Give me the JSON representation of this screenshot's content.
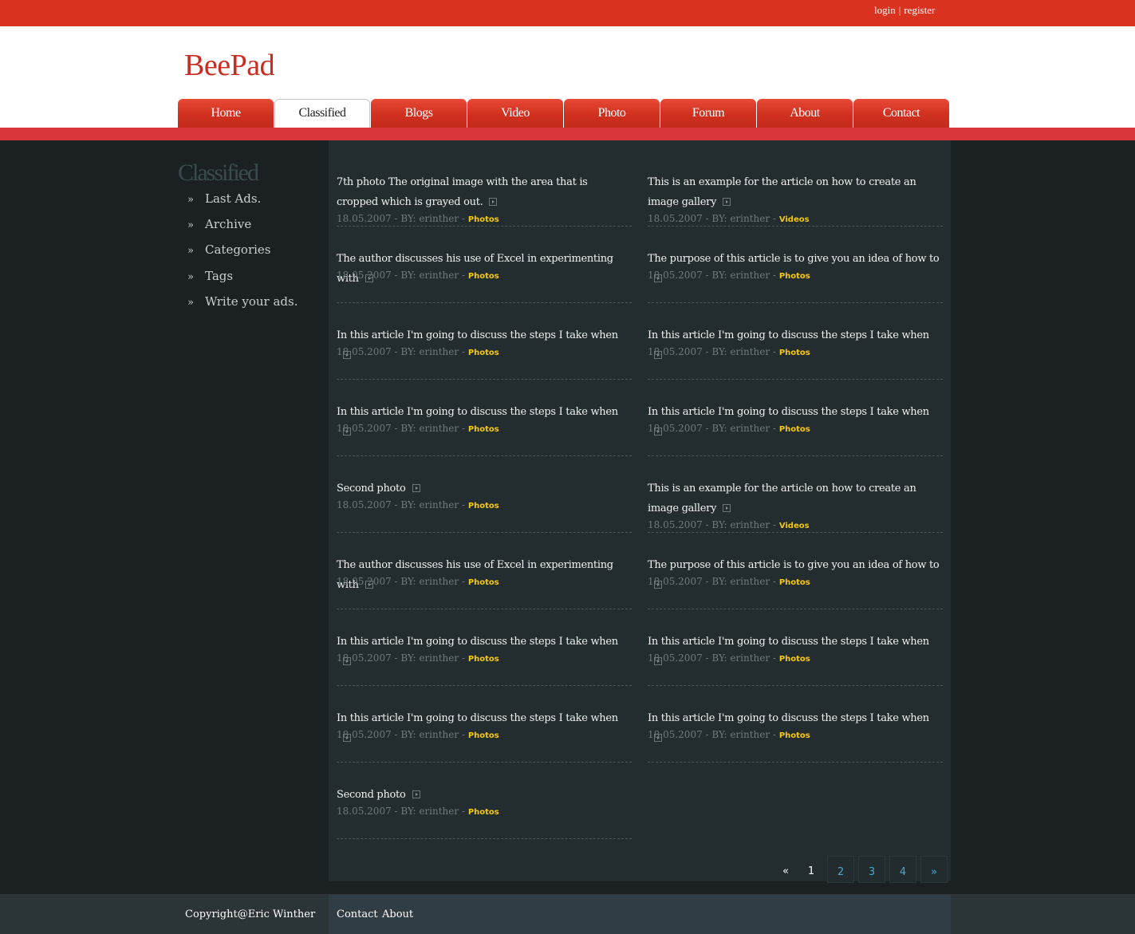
{
  "topbar": {
    "login": "login",
    "separator": "|",
    "register": "register"
  },
  "site": {
    "logo": "BeePad"
  },
  "nav": {
    "tabs": [
      "Home",
      "Classified",
      "Blogs",
      "Video",
      "Photo",
      "Forum",
      "About",
      "Contact"
    ],
    "active": "Classified"
  },
  "sidebar": {
    "title": "Classified",
    "bullet": "»",
    "items": [
      "Last Ads.",
      "Archive",
      "Categories",
      "Tags",
      "Write your ads."
    ]
  },
  "articles": {
    "date": "18.05.2007",
    "by": "- BY: erinther -",
    "left": [
      {
        "title": "7th photo The original image with the area that is cropped which is grayed out.",
        "category": "Photos"
      },
      {
        "title": "The author discusses his use of Excel in experimenting with",
        "category": "Photos"
      },
      {
        "title": "In this article I'm going to discuss the steps I take when",
        "category": "Photos"
      },
      {
        "title": "In this article I'm going to discuss the steps I take when",
        "category": "Photos"
      },
      {
        "title": "Second photo",
        "category": "Photos"
      },
      {
        "title": "The author discusses his use of Excel in experimenting with",
        "category": "Photos"
      },
      {
        "title": "In this article I'm going to discuss the steps I take when",
        "category": "Photos"
      },
      {
        "title": "In this article I'm going to discuss the steps I take when",
        "category": "Photos"
      },
      {
        "title": "Second photo",
        "category": "Photos"
      }
    ],
    "right": [
      {
        "title": "This is an example for the article on how to create an image gallery",
        "category": "Videos"
      },
      {
        "title": "The purpose of this article is to give you an idea of how to",
        "category": "Photos"
      },
      {
        "title": "In this article I'm going to discuss the steps I take when",
        "category": "Photos"
      },
      {
        "title": "In this article I'm going to discuss the steps I take when",
        "category": "Photos"
      },
      {
        "title": "This is an example for the article on how to create an image gallery",
        "category": "Videos"
      },
      {
        "title": "The purpose of this article is to give you an idea of how to",
        "category": "Photos"
      },
      {
        "title": "In this article I'm going to discuss the steps I take when",
        "category": "Photos"
      },
      {
        "title": "In this article I'm going to discuss the steps I take when",
        "category": "Photos"
      }
    ]
  },
  "pagination": {
    "prev": "«",
    "current": "1",
    "pages": [
      "2",
      "3",
      "4"
    ],
    "next": "»"
  },
  "footer": {
    "copyright": "Copyright@Eric Winther",
    "links": [
      "Contact",
      "About"
    ]
  },
  "colors": {
    "brand_red": "#d9321e",
    "link_yellow": "#f5c80e",
    "page_link_blue": "#4aa6d8"
  }
}
